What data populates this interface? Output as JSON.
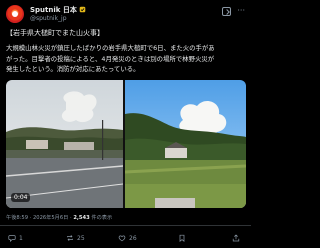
{
  "account": {
    "name": "Sputnik 日本",
    "handle": "@sputnik_jp"
  },
  "post": {
    "headline": "【岩手県大槌町でまた山火事】",
    "body_line1": "大規模山林火災が鎮圧したばかりの岩手県大槌町で6日、また火の手があ",
    "body_line2": "がった。目撃者の投稿によると、4月発災のときは別の場所で林野火災が",
    "body_line3": "発生したという。消防が対応にあたっている。",
    "video_duration": "0:04",
    "timestamp": "午後8:59 · 2026年5月6日",
    "views_count": "2,543",
    "views_label": "件の表示"
  },
  "actions": {
    "replies": "1",
    "reposts": "25",
    "likes": "26"
  },
  "colors": {
    "background": "#000000",
    "text": "#e7e9ea",
    "muted": "#8b98a5",
    "verified": "#e2b719",
    "divider": "#2f3336"
  },
  "icons": [
    "verified-badge-icon",
    "grok-icon",
    "more-icon",
    "reply-icon",
    "repost-icon",
    "like-icon",
    "bookmark-icon",
    "share-icon"
  ]
}
